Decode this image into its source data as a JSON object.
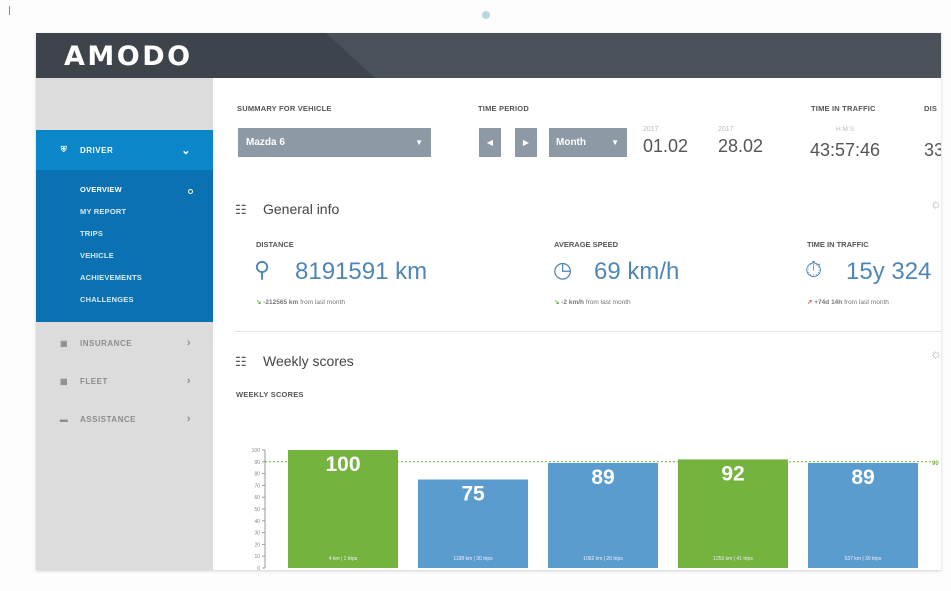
{
  "brand": {
    "logo": "AMODO"
  },
  "sidebar": {
    "driver": {
      "label": "DRIVER",
      "icon": "car-icon"
    },
    "sub_items": [
      "OVERVIEW",
      "MY REPORT",
      "TRIPS",
      "VEHICLE",
      "ACHIEVEMENTS",
      "CHALLENGES"
    ],
    "items": [
      {
        "label": "INSURANCE",
        "icon": "shield-icon"
      },
      {
        "label": "FLEET",
        "icon": "truck-icon"
      },
      {
        "label": "ASSISTANCE",
        "icon": "tow-truck-icon"
      }
    ]
  },
  "summary": {
    "label": "SUMMARY FOR VEHICLE",
    "vehicle": "Mazda 6"
  },
  "time_period": {
    "label": "TIME PERIOD",
    "period": "Month",
    "from_year": "2017",
    "from_date": "01.02",
    "to_year": "2017",
    "to_date": "28.02"
  },
  "traffic_header": {
    "label": "TIME IN TRAFFIC",
    "unit": "H:M:S",
    "value": "43:57:46"
  },
  "cut_header": {
    "label": "DIS",
    "value": "33"
  },
  "general_info": {
    "title": "General info",
    "distance": {
      "label": "DISTANCE",
      "value": "8191591 km",
      "note_value": "-212565 km",
      "note_text": "from last month",
      "trend": "down"
    },
    "avg_speed": {
      "label": "AVERAGE SPEED",
      "value": "69 km/h",
      "note_value": "-2 km/h",
      "note_text": "from last month",
      "trend": "down"
    },
    "traffic": {
      "label": "TIME IN TRAFFIC",
      "value": "15y 324",
      "note_value": "+74d 14h",
      "note_text": "from last month",
      "trend": "up"
    }
  },
  "weekly": {
    "title": "Weekly scores",
    "chart_label": "WEEKLY SCORES"
  },
  "colors": {
    "accent": "#0a86c9",
    "sidebar_dark": "#0a72b3",
    "green": "#74b43e",
    "blue": "#5b9ccf"
  },
  "chart_data": {
    "type": "bar",
    "title": "WEEKLY SCORES",
    "categories": [
      "30 - 05 Feb 2017",
      "06 - 12 Feb 2017",
      "13 - 19 Feb 2017",
      "20 - 26 Feb 2017",
      "27 - 05 Mar 2017"
    ],
    "values": [
      100,
      75,
      89,
      92,
      89
    ],
    "bar_notes": [
      "4 km | 1 trips",
      "1188 km | 30 trips",
      "1062 km | 26 trips",
      "1253 km | 41 trips",
      "537 km | 30 trips"
    ],
    "colors": [
      "#74b43e",
      "#5b9ccf",
      "#5b9ccf",
      "#74b43e",
      "#5b9ccf"
    ],
    "reference_value": 90,
    "reference_label": "90",
    "yticks": [
      0,
      10,
      20,
      30,
      40,
      50,
      60,
      70,
      80,
      90,
      100
    ],
    "ylim": [
      0,
      100
    ],
    "grid": false
  }
}
